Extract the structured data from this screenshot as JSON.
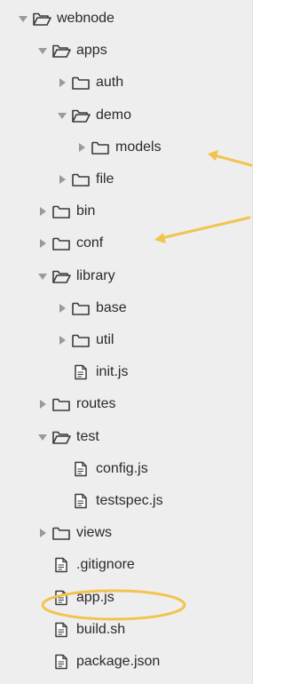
{
  "tree": [
    {
      "label": "webnode",
      "type": "folder",
      "state": "open",
      "level": 0
    },
    {
      "label": "apps",
      "type": "folder",
      "state": "open",
      "level": 1
    },
    {
      "label": "auth",
      "type": "folder",
      "state": "closed",
      "level": 2
    },
    {
      "label": "demo",
      "type": "folder",
      "state": "open",
      "level": 2
    },
    {
      "label": "models",
      "type": "folder",
      "state": "closed",
      "level": 3
    },
    {
      "label": "file",
      "type": "folder",
      "state": "closed",
      "level": 2
    },
    {
      "label": "bin",
      "type": "folder",
      "state": "closed",
      "level": 1
    },
    {
      "label": "conf",
      "type": "folder",
      "state": "closed",
      "level": 1
    },
    {
      "label": "library",
      "type": "folder",
      "state": "open",
      "level": 1
    },
    {
      "label": "base",
      "type": "folder",
      "state": "closed",
      "level": 2
    },
    {
      "label": "util",
      "type": "folder",
      "state": "closed",
      "level": 2
    },
    {
      "label": "init.js",
      "type": "file",
      "level": 2
    },
    {
      "label": "routes",
      "type": "folder",
      "state": "closed",
      "level": 1
    },
    {
      "label": "test",
      "type": "folder",
      "state": "open",
      "level": 1
    },
    {
      "label": "config.js",
      "type": "file",
      "level": 2
    },
    {
      "label": "testspec.js",
      "type": "file",
      "level": 2
    },
    {
      "label": "views",
      "type": "folder",
      "state": "closed",
      "level": 1
    },
    {
      "label": ".gitignore",
      "type": "file",
      "level": 1
    },
    {
      "label": "app.js",
      "type": "file",
      "level": 1,
      "highlight": "circled"
    },
    {
      "label": "build.sh",
      "type": "file",
      "level": 1
    },
    {
      "label": "package.json",
      "type": "file",
      "level": 1
    }
  ],
  "annotations": {
    "arrow_targets": [
      "models",
      "conf"
    ],
    "circled": "app.js",
    "accent_color": "#f2c44e"
  },
  "colors": {
    "panel_bg": "#eeeeee",
    "text": "#2a2a2a",
    "icon_stroke": "#3a3a3a",
    "twisty": "#9a9a9a"
  },
  "icons": {
    "folder_closed": "folder-icon",
    "folder_open": "folder-open-icon",
    "file": "file-icon",
    "twisty_open": "triangle-down-icon",
    "twisty_closed": "triangle-right-icon"
  }
}
